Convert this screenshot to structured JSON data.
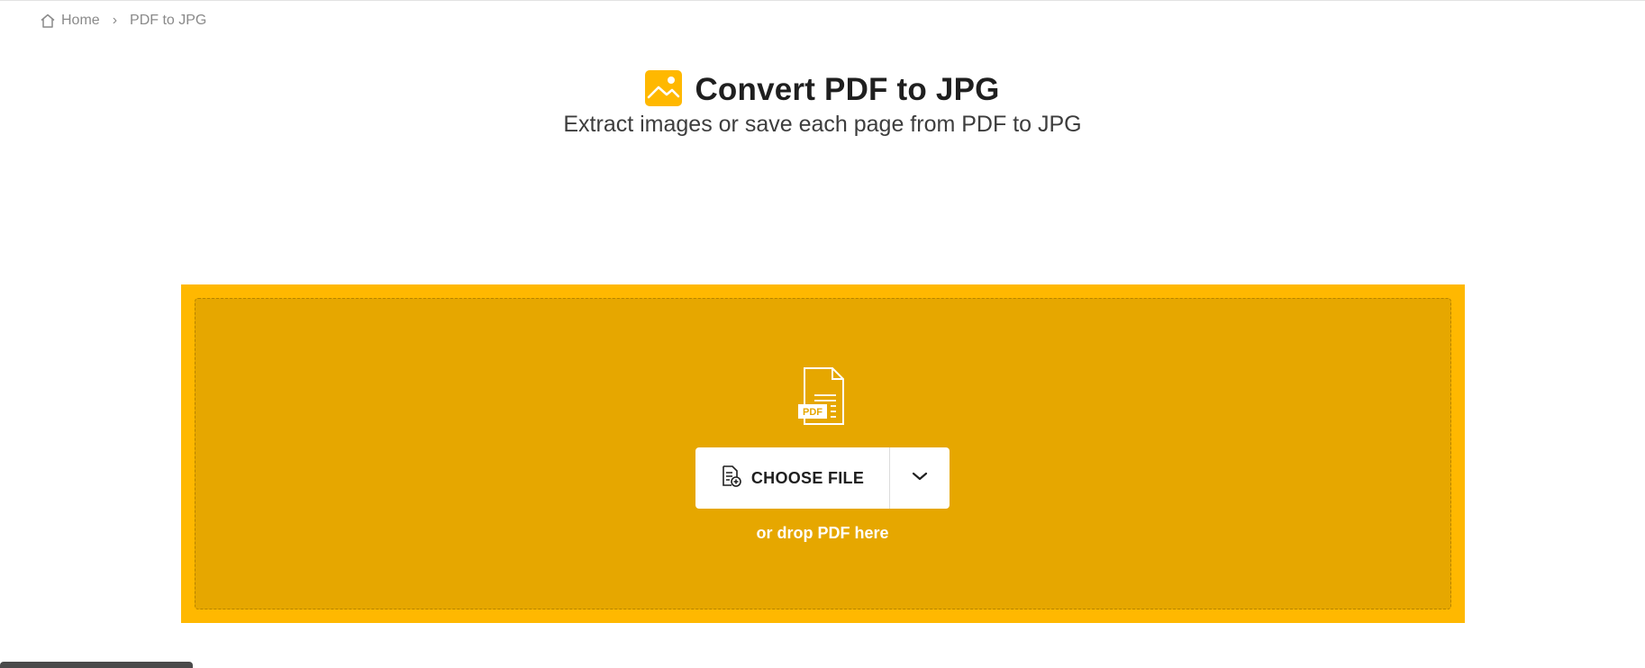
{
  "breadcrumb": {
    "home_label": "Home",
    "separator": "›",
    "current_label": "PDF to JPG",
    "home_icon": "home-icon"
  },
  "hero": {
    "title": "Convert PDF to JPG",
    "subtitle": "Extract images or save each page from PDF to JPG",
    "title_icon": "image-icon"
  },
  "dropzone": {
    "file_icon": "pdf-file-icon",
    "file_badge": "PDF",
    "choose_label": "CHOOSE FILE",
    "choose_icon": "add-file-icon",
    "dropdown_icon": "chevron-down-icon",
    "hint": "or drop PDF here"
  },
  "colors": {
    "accent": "#ffb800",
    "dropzone_inner": "#e6a700",
    "dash": "#b68300",
    "title_text": "#1f1f1f",
    "breadcrumb_text": "#8a8a8a"
  }
}
